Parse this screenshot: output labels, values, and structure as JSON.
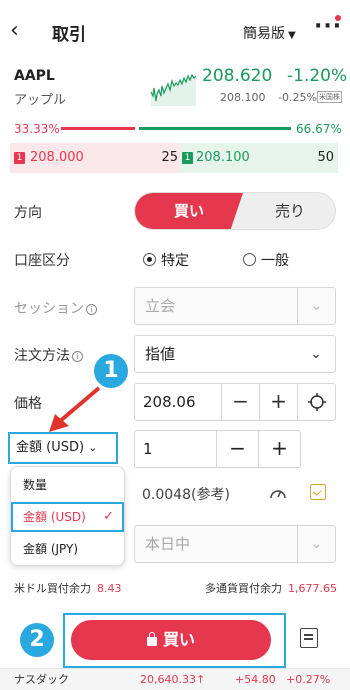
{
  "header": {
    "title": "取引",
    "mode": "簡易版"
  },
  "quote": {
    "symbol": "AAPL",
    "name": "アップル",
    "price": "208.620",
    "change_pct": "-1.20%",
    "prev": "208.100",
    "prev_change_pct": "-0.25%",
    "badge": "米国株"
  },
  "book_ratio": {
    "bid_pct": "33.33%",
    "ask_pct": "66.67%",
    "bid_ratio": 0.3333,
    "ask_ratio": 0.6667
  },
  "book": {
    "bid": {
      "level": "1",
      "price": "208.000",
      "size": "25"
    },
    "ask": {
      "level": "1",
      "price": "208.100",
      "size": "50"
    }
  },
  "form": {
    "direction_label": "方向",
    "buy_label": "買い",
    "sell_label": "売り",
    "account_label": "口座区分",
    "account_opt1": "特定",
    "account_opt2": "一般",
    "session_label": "セッション",
    "session_value": "立会",
    "order_type_label": "注文方法",
    "order_type_value": "指値",
    "price_label": "価格",
    "price_value": "208.06",
    "amount_select": "金額 (USD)",
    "amount_value": "1",
    "qty_ref": "0.0048(参考)",
    "expiry_value": "本日中",
    "minus": "−",
    "plus": "+"
  },
  "dropdown": {
    "items": [
      "数量",
      "金額 (USD)",
      "金額 (JPY)"
    ],
    "selected_mark": "✓"
  },
  "buying_power": {
    "usd_label": "米ドル買付余力",
    "usd_value": "8.43",
    "multi_label": "多通貨買付余力",
    "multi_value": "1,677.65"
  },
  "buy_button": "買い",
  "annotations": {
    "one": "1",
    "two": "2"
  },
  "ticker": {
    "name": "ナスダック",
    "price": "20,640.33↑",
    "change": "+54.80",
    "change_pct": "+0.27%"
  },
  "colors": {
    "red": "#e5384f",
    "green": "#1a9a5c",
    "annotation_blue": "#2aa8e0"
  }
}
